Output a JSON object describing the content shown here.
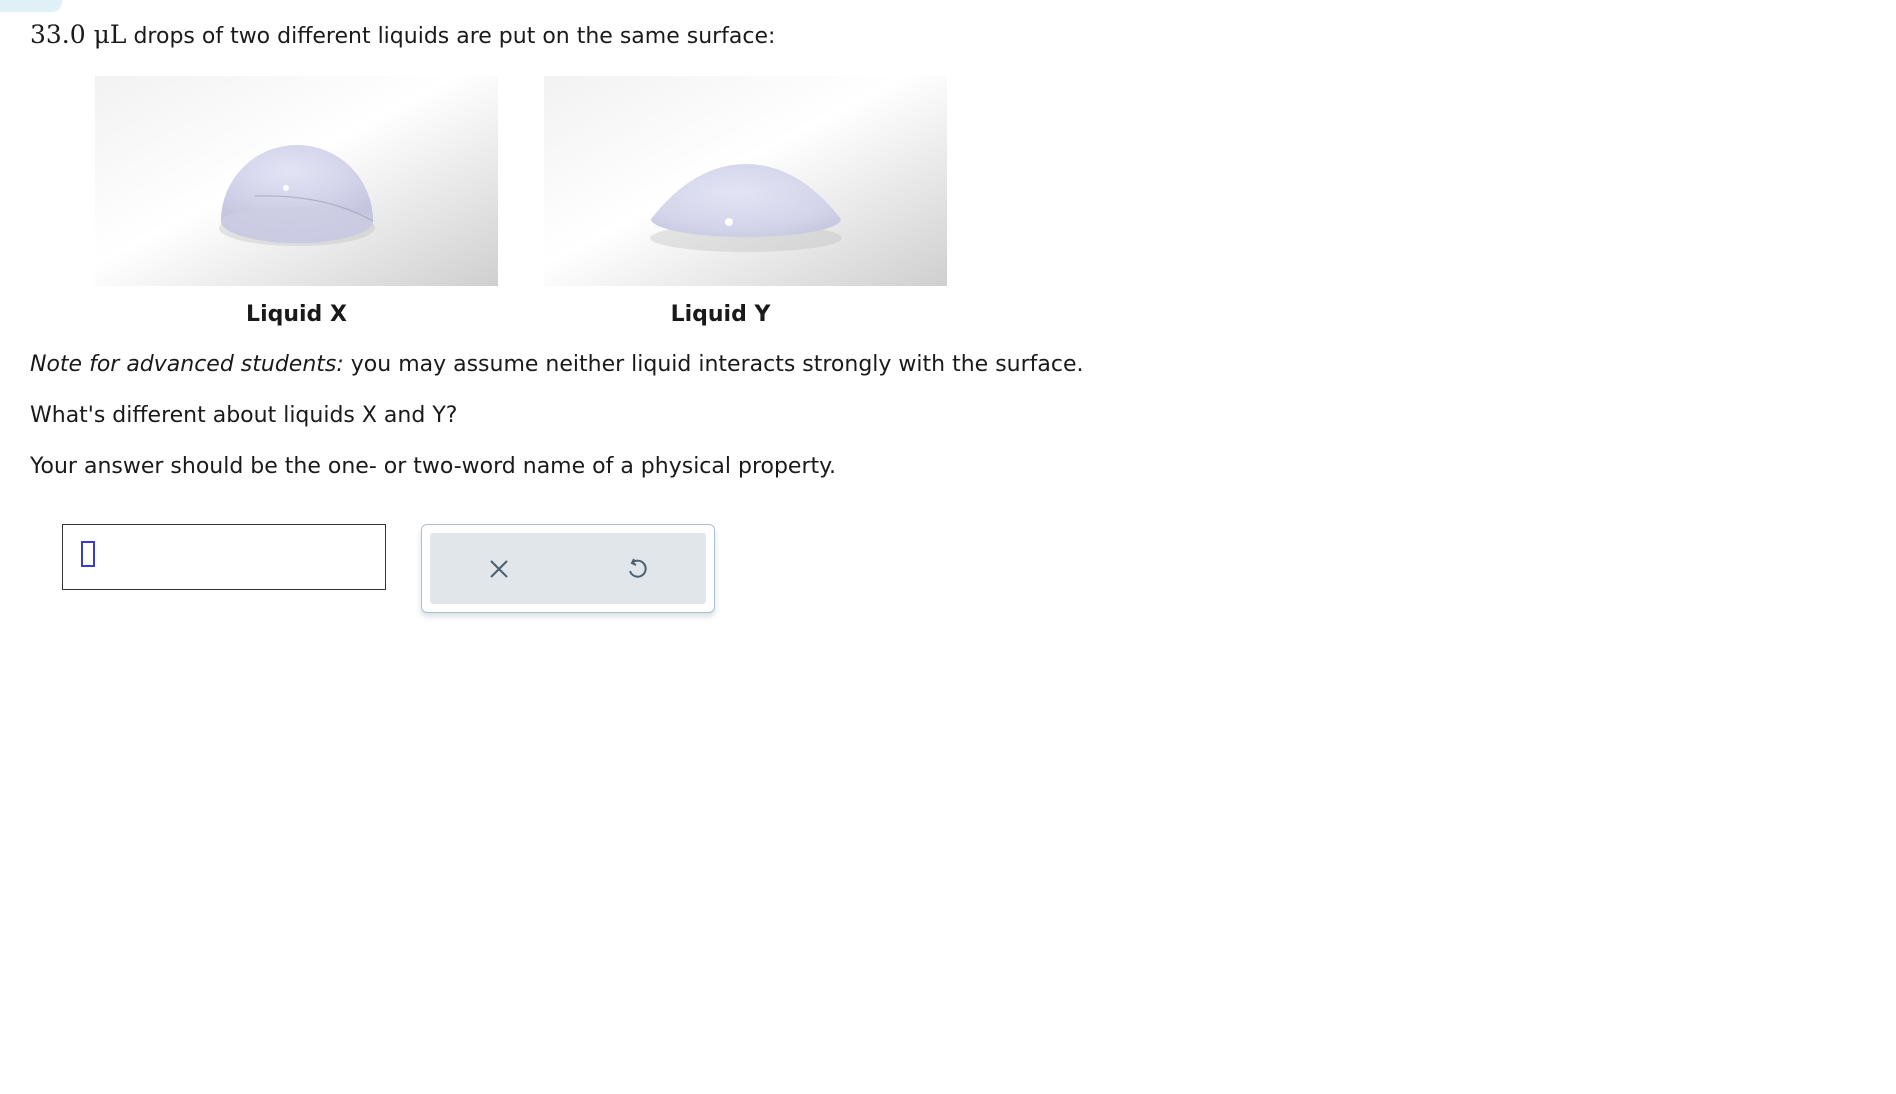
{
  "question": {
    "amount": "33.0 μL",
    "intro": " drops of two different liquids are put on the same surface:"
  },
  "figures": {
    "liquid_x_caption": "Liquid X",
    "liquid_y_caption": "Liquid Y",
    "drop_color": "#d6d7ec",
    "background_color": "#e4e4e4"
  },
  "note": {
    "label": "Note for advanced students:",
    "text": " you may assume neither liquid interacts strongly with the surface."
  },
  "prompt": "What's different about liquids X and Y?",
  "instruction": "Your answer should be the one- or two-word name of a physical property.",
  "answer": {
    "value": ""
  },
  "toolbar": {
    "clear_icon": "close-icon",
    "undo_icon": "undo-icon"
  }
}
